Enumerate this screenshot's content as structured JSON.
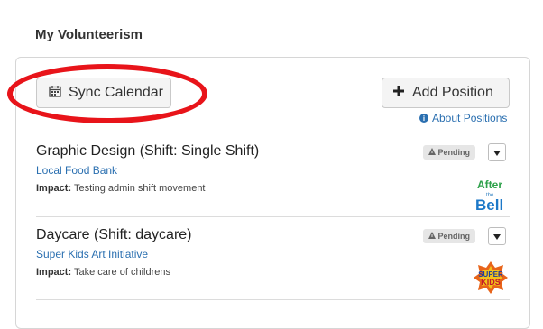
{
  "section_title": "My Volunteerism",
  "toolbar": {
    "sync_label": "Sync Calendar",
    "add_label": "Add Position",
    "about_label": "About Positions"
  },
  "impact_prefix": "Impact:",
  "positions": [
    {
      "title": "Graphic Design (Shift: Single Shift)",
      "organization": "Local Food Bank",
      "impact": "Testing admin shift movement",
      "status": "Pending",
      "logo": {
        "line1": "After",
        "line2": "the",
        "line3": "Bell"
      }
    },
    {
      "title": "Daycare (Shift: daycare)",
      "organization": "Super Kids Art Initiative",
      "impact": "Take care of childrens",
      "status": "Pending",
      "logo": {
        "line1": "SUPER",
        "line2": "KIDS"
      }
    }
  ],
  "colors": {
    "link": "#2a6fb0",
    "annotation_circle": "#e8141a",
    "badge_bg": "#e6e6e6"
  }
}
